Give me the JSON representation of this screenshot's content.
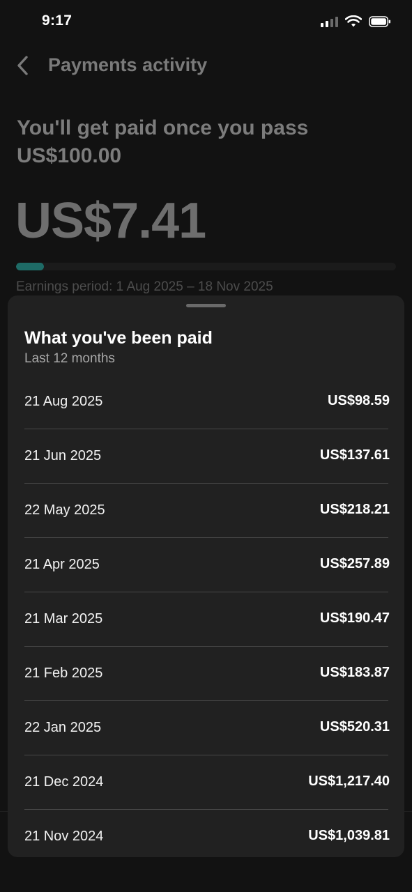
{
  "status_bar": {
    "time": "9:17"
  },
  "header": {
    "back_icon": "chevron-left-icon",
    "title": "Payments activity"
  },
  "summary": {
    "headline": "You'll get paid once you pass US$100.00",
    "balance": "US$7.41",
    "progress_fraction": 0.074,
    "earnings_period": "Earnings period: 1 Aug 2025 – 18 Nov 2025"
  },
  "sheet": {
    "title": "What you've been paid",
    "subtitle": "Last 12 months",
    "payments": [
      {
        "date": "21 Aug 2025",
        "amount": "US$98.59"
      },
      {
        "date": "21 Jun 2025",
        "amount": "US$137.61"
      },
      {
        "date": "22 May 2025",
        "amount": "US$218.21"
      },
      {
        "date": "21 Apr 2025",
        "amount": "US$257.89"
      },
      {
        "date": "21 Mar 2025",
        "amount": "US$190.47"
      },
      {
        "date": "21 Feb 2025",
        "amount": "US$183.87"
      },
      {
        "date": "22 Jan 2025",
        "amount": "US$520.31"
      },
      {
        "date": "21 Dec 2024",
        "amount": "US$1,217.40"
      },
      {
        "date": "21 Nov 2024",
        "amount": "US$1,039.81"
      }
    ]
  },
  "colors": {
    "accent": "#1e6b66",
    "sheet_background": "#212121",
    "page_background": "#121212"
  }
}
